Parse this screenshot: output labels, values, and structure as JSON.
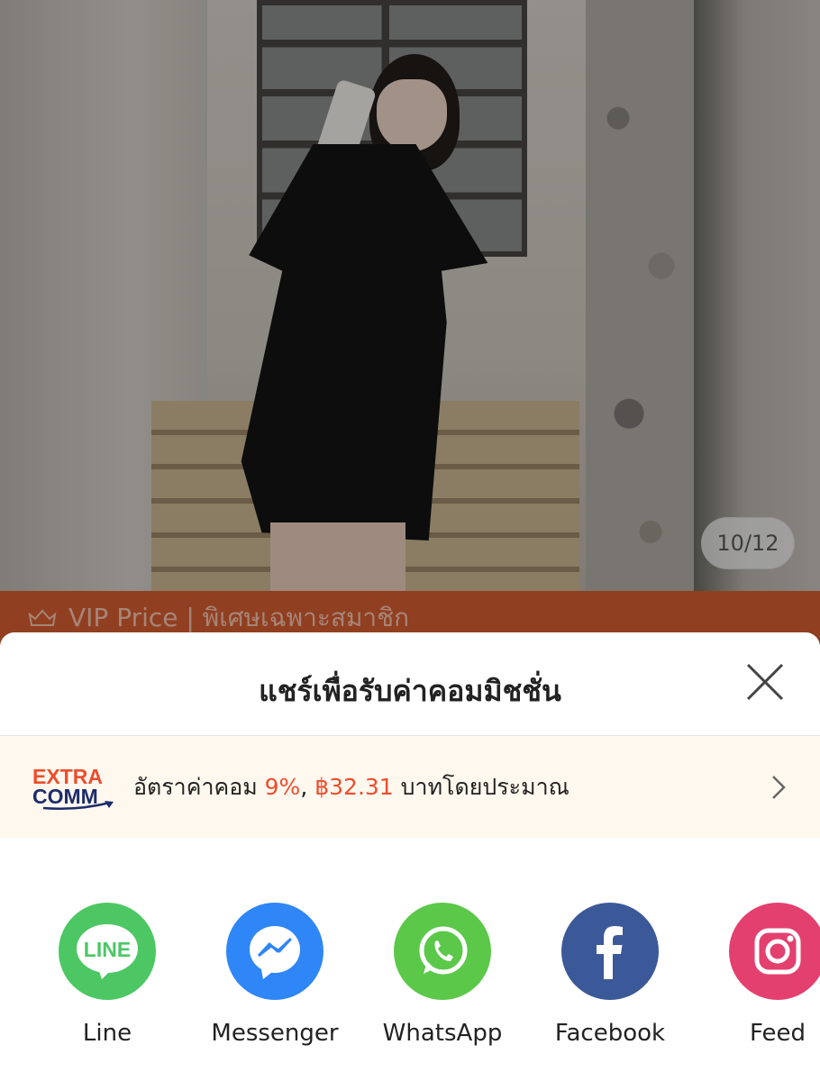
{
  "product": {
    "image_counter": "10/12",
    "vip_banner": "VIP Price | พิเศษเฉพาะสมาชิก"
  },
  "share_sheet": {
    "title": "แชร์เพื่อรับค่าคอมมิชชั่น",
    "extra_comm": {
      "logo_line1": "EXTRA",
      "logo_line2": "COMM",
      "text_prefix": "อัตราค่าคอม ",
      "rate": "9%",
      "separator": ", ",
      "amount": "฿32.31",
      "text_suffix": " บาทโดยประมาณ"
    },
    "apps": [
      {
        "label": "Line",
        "icon": "line-icon",
        "color": "#4cc764"
      },
      {
        "label": "Messenger",
        "icon": "messenger-icon",
        "color": "#2f86f6"
      },
      {
        "label": "WhatsApp",
        "icon": "whatsapp-icon",
        "color": "#5bc84a"
      },
      {
        "label": "Facebook",
        "icon": "facebook-icon",
        "color": "#3b5998"
      },
      {
        "label": "Feed",
        "icon": "instagram-icon",
        "color": "#e4406f"
      }
    ]
  },
  "colors": {
    "accent": "#ee4d2d",
    "vip_banner": "#c9582f",
    "extra_bg": "#fff8ee"
  }
}
